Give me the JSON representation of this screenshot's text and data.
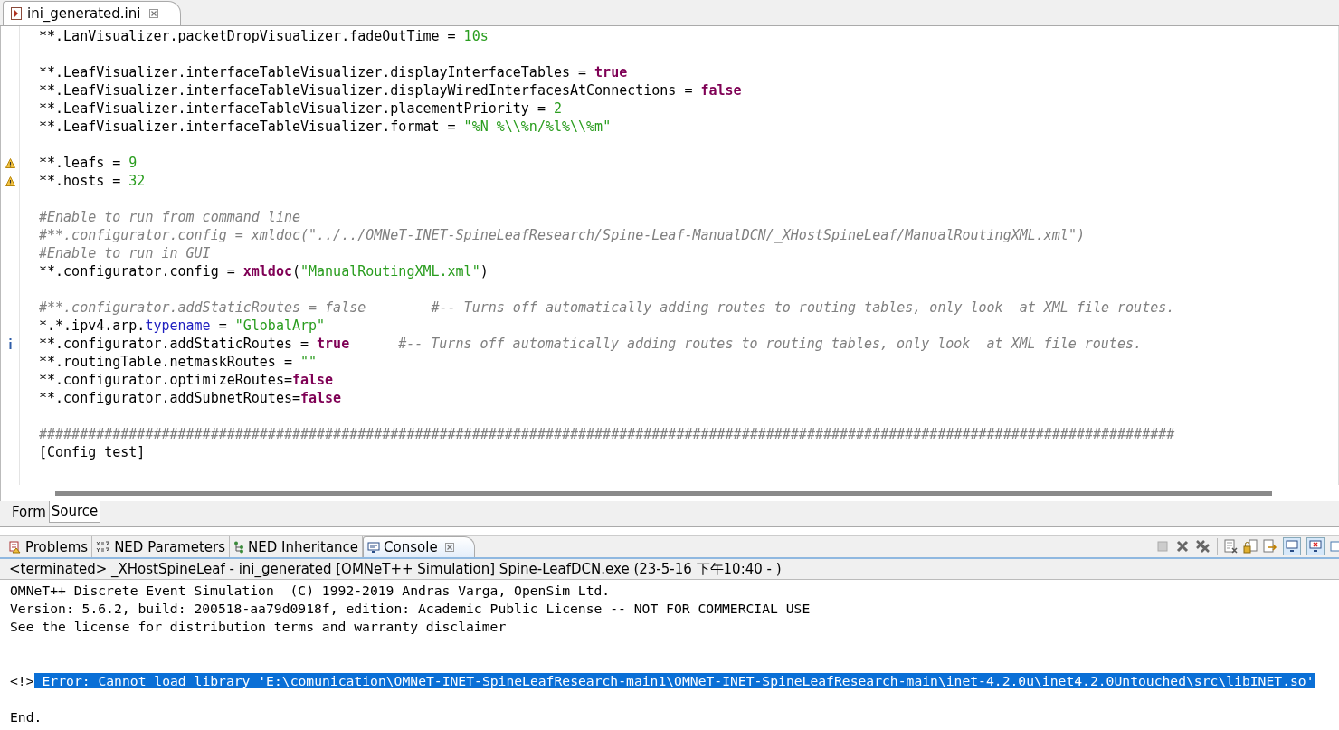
{
  "editor_tab": {
    "title": "ini_generated.ini"
  },
  "editor": {
    "lines": [
      {
        "kind": "code",
        "segments": [
          {
            "kind": "plain",
            "text": "**.LanVisualizer.packetDropVisualizer.fadeOutTime = "
          },
          {
            "kind": "number",
            "text": "10s"
          }
        ]
      },
      {
        "kind": "blank"
      },
      {
        "kind": "code",
        "segments": [
          {
            "kind": "plain",
            "text": "**.LeafVisualizer.interfaceTableVisualizer.displayInterfaceTables = "
          },
          {
            "kind": "keyword",
            "text": "true"
          }
        ]
      },
      {
        "kind": "code",
        "segments": [
          {
            "kind": "plain",
            "text": "**.LeafVisualizer.interfaceTableVisualizer.displayWiredInterfacesAtConnections = "
          },
          {
            "kind": "keyword",
            "text": "false"
          }
        ]
      },
      {
        "kind": "code",
        "segments": [
          {
            "kind": "plain",
            "text": "**.LeafVisualizer.interfaceTableVisualizer.placementPriority = "
          },
          {
            "kind": "number",
            "text": "2"
          }
        ]
      },
      {
        "kind": "code",
        "segments": [
          {
            "kind": "plain",
            "text": "**.LeafVisualizer.interfaceTableVisualizer.format = "
          },
          {
            "kind": "string",
            "text": "\"%N %\\\\%n/%l%\\\\%m\""
          }
        ]
      },
      {
        "kind": "blank"
      },
      {
        "kind": "code",
        "warning": true,
        "segments": [
          {
            "kind": "plain",
            "text": "**.leafs = "
          },
          {
            "kind": "number",
            "text": "9"
          }
        ]
      },
      {
        "kind": "code",
        "warning": true,
        "segments": [
          {
            "kind": "plain",
            "text": "**.hosts = "
          },
          {
            "kind": "number",
            "text": "32"
          }
        ]
      },
      {
        "kind": "blank"
      },
      {
        "kind": "code",
        "segments": [
          {
            "kind": "comment",
            "text": "#Enable to run from command line"
          }
        ]
      },
      {
        "kind": "code",
        "segments": [
          {
            "kind": "comment",
            "text": "#**.configurator.config = xmldoc(\"../../OMNeT-INET-SpineLeafResearch/Spine-Leaf-ManualDCN/_XHostSpineLeaf/ManualRoutingXML.xml\")"
          }
        ]
      },
      {
        "kind": "code",
        "segments": [
          {
            "kind": "comment",
            "text": "#Enable to run in GUI"
          }
        ]
      },
      {
        "kind": "code",
        "segments": [
          {
            "kind": "plain",
            "text": "**.configurator.config = "
          },
          {
            "kind": "keyword",
            "text": "xmldoc"
          },
          {
            "kind": "plain",
            "text": "("
          },
          {
            "kind": "string",
            "text": "\"ManualRoutingXML.xml\""
          },
          {
            "kind": "plain",
            "text": ")"
          }
        ]
      },
      {
        "kind": "blank"
      },
      {
        "kind": "code",
        "segments": [
          {
            "kind": "comment",
            "text": "#**.configurator.addStaticRoutes = false        #-- Turns off automatically adding routes to routing tables, only look  at XML file routes."
          }
        ]
      },
      {
        "kind": "code",
        "segments": [
          {
            "kind": "plain",
            "text": "*.*.ipv4.arp."
          },
          {
            "kind": "type",
            "text": "typename"
          },
          {
            "kind": "plain",
            "text": " = "
          },
          {
            "kind": "string",
            "text": "\"GlobalArp\""
          }
        ]
      },
      {
        "kind": "code",
        "info": true,
        "segments": [
          {
            "kind": "plain",
            "text": "**.configurator.addStaticRoutes = "
          },
          {
            "kind": "keyword",
            "text": "true"
          },
          {
            "kind": "trailing_comment",
            "text": "#-- Turns off automatically adding routes to routing tables, only look  at XML file routes."
          }
        ]
      },
      {
        "kind": "code",
        "segments": [
          {
            "kind": "plain",
            "text": "**.routingTable.netmaskRoutes = "
          },
          {
            "kind": "string",
            "text": "\"\""
          }
        ]
      },
      {
        "kind": "code",
        "segments": [
          {
            "kind": "plain",
            "text": "**.configurator.optimizeRoutes="
          },
          {
            "kind": "keyword",
            "text": "false"
          }
        ]
      },
      {
        "kind": "code",
        "segments": [
          {
            "kind": "plain",
            "text": "**.configurator.addSubnetRoutes="
          },
          {
            "kind": "keyword",
            "text": "false"
          }
        ]
      },
      {
        "kind": "blank"
      },
      {
        "kind": "code",
        "segments": [
          {
            "kind": "comment",
            "text": "###########################################################################################################################################"
          }
        ]
      },
      {
        "kind": "code",
        "segments": [
          {
            "kind": "plain",
            "text": "[Config test]"
          }
        ]
      }
    ]
  },
  "editor_mode_tabs": [
    {
      "label": "Form",
      "selected": false
    },
    {
      "label": "Source",
      "selected": true
    }
  ],
  "view_tabs": [
    {
      "label": "Problems",
      "kind": "problems",
      "selected": false
    },
    {
      "label": "NED Parameters",
      "kind": "parameters",
      "selected": false
    },
    {
      "label": "NED Inheritance",
      "kind": "tree",
      "selected": false
    },
    {
      "label": "Console",
      "kind": "console",
      "selected": true
    }
  ],
  "console": {
    "header": "<terminated> _XHostSpineLeaf - ini_generated [OMNeT++ Simulation] Spine-LeafDCN.exe (23-5-16 下午10:40 - )",
    "lines": [
      {
        "kind": "text",
        "text": "OMNeT++ Discrete Event Simulation  (C) 1992-2019 Andras Varga, OpenSim Ltd."
      },
      {
        "kind": "text",
        "text": "Version: 5.6.2, build: 200518-aa79d0918f, edition: Academic Public License -- NOT FOR COMMERCIAL USE"
      },
      {
        "kind": "text",
        "text": "See the license for distribution terms and warranty disclaimer"
      },
      {
        "kind": "blank"
      },
      {
        "kind": "blank"
      },
      {
        "kind": "error",
        "prefix": "<!>",
        "text": "Error: Cannot load library 'E:\\comunication\\OMNeT-INET-SpineLeafResearch-main1\\OMNeT-INET-SpineLeafResearch-main\\inet-4.2.0u\\inet4.2.0Untouched\\src\\libINET.so'",
        "selected": true
      },
      {
        "kind": "blank"
      },
      {
        "kind": "text",
        "text": "End."
      }
    ]
  }
}
